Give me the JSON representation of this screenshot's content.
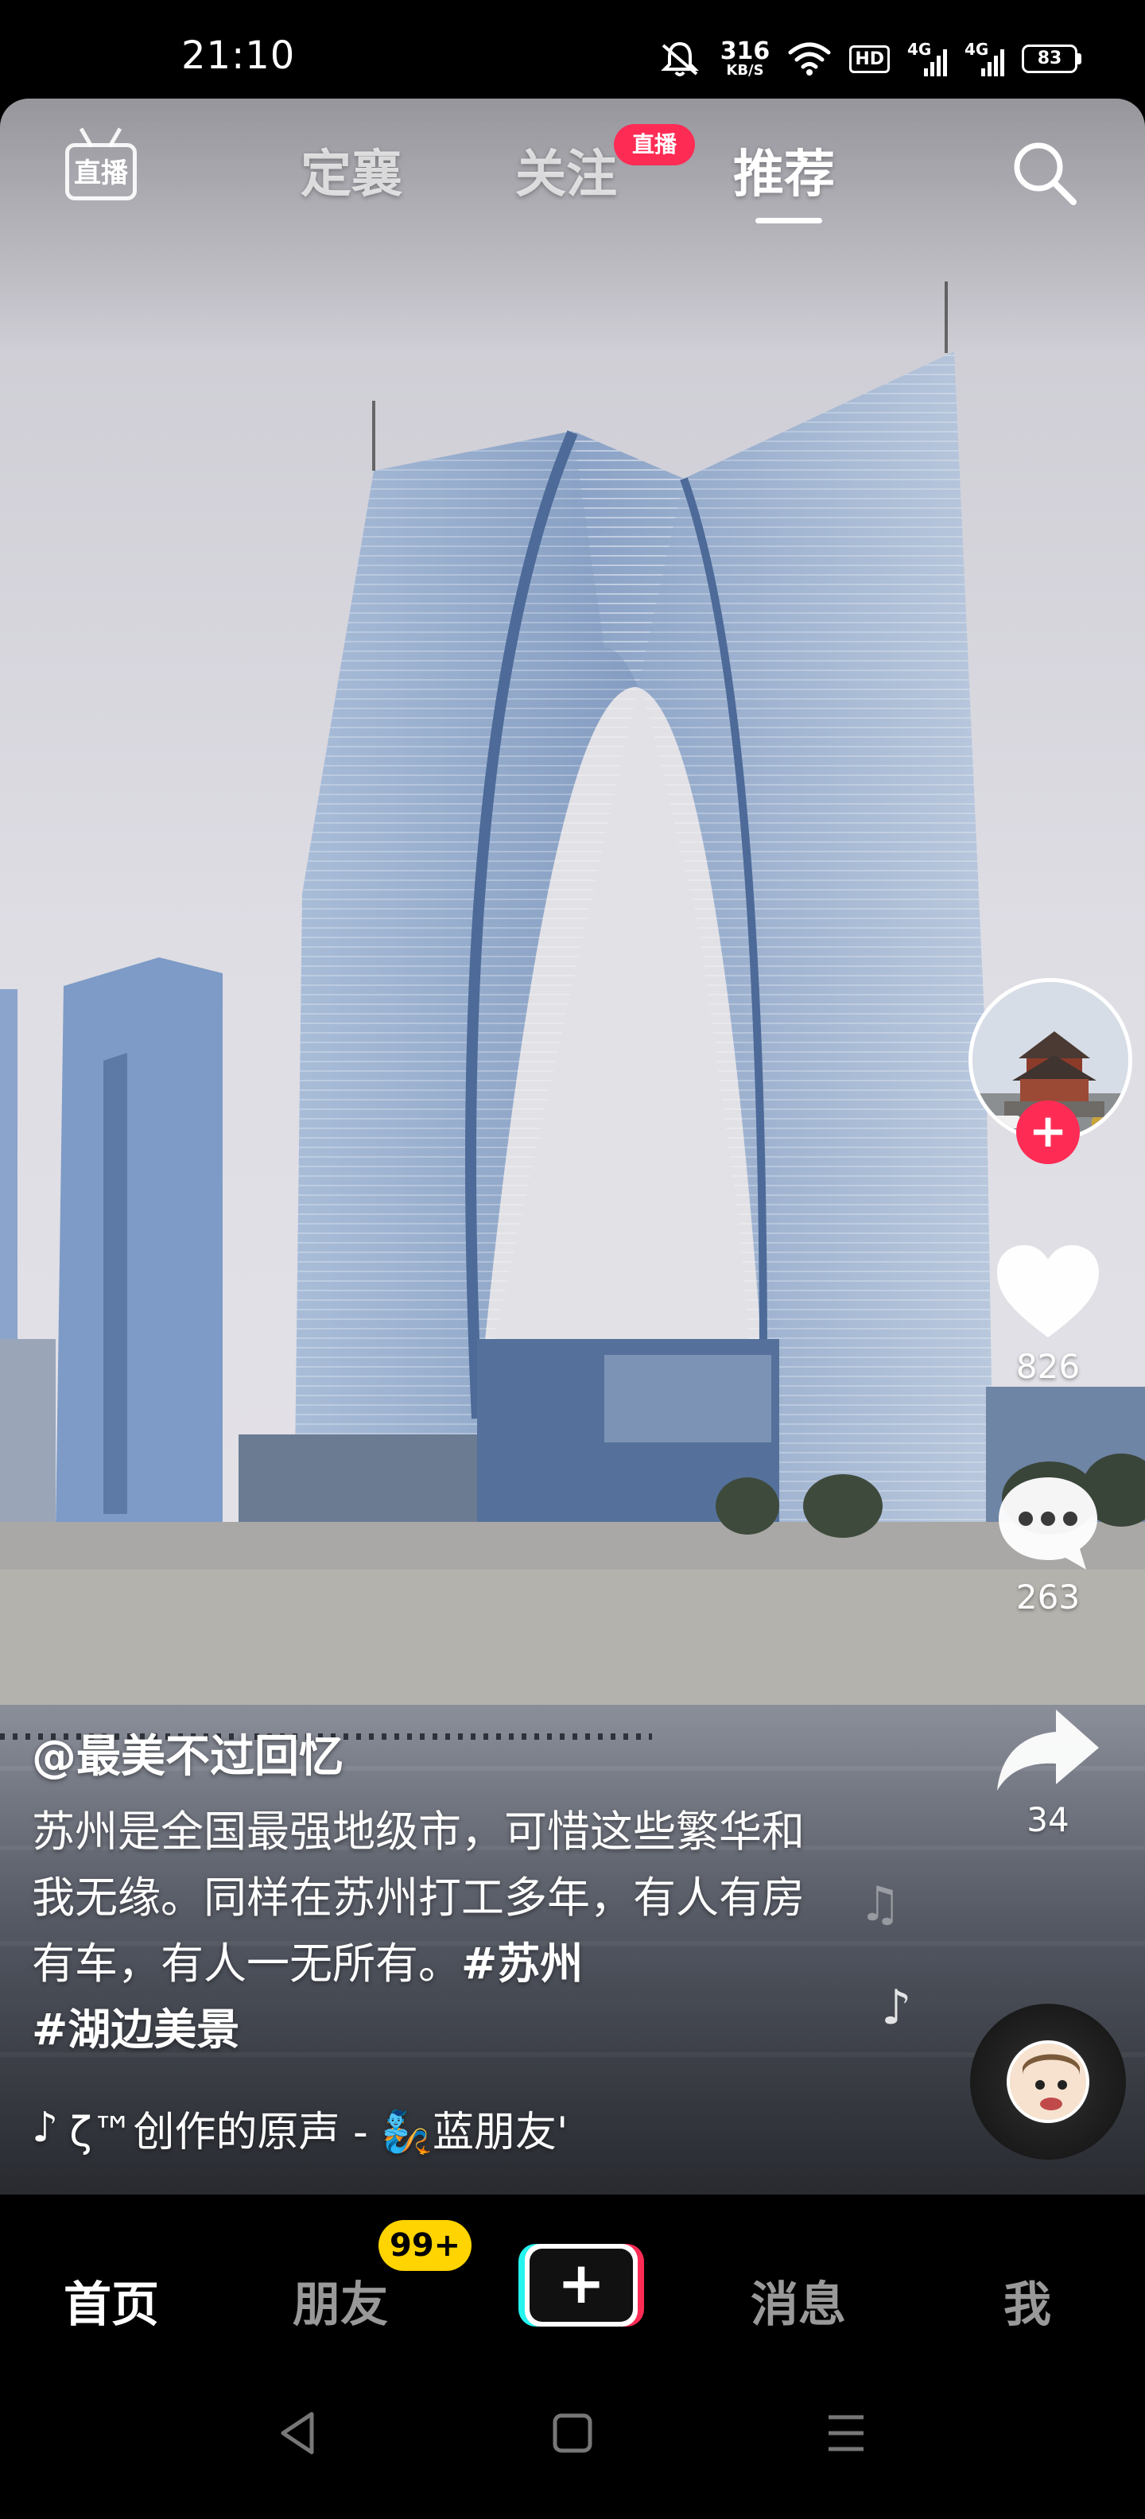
{
  "status_bar": {
    "time": "21:10",
    "net_speed_value": "316",
    "net_speed_unit": "KB/S",
    "hd_label": "HD",
    "sim1_label": "4G",
    "sim2_label": "4G",
    "battery": "83",
    "icons": [
      "mute-icon",
      "wifi-icon",
      "hd-icon",
      "signal-icon",
      "signal-icon",
      "battery-icon"
    ]
  },
  "top_nav": {
    "live_label": "直播",
    "tabs": [
      {
        "label": "定襄"
      },
      {
        "label": "关注"
      },
      {
        "label": "推荐"
      }
    ],
    "active_tab": "推荐",
    "follow_badge": "直播"
  },
  "actions": {
    "likes": "826",
    "comments": "263",
    "shares": "34",
    "follow_plus": "+"
  },
  "post": {
    "author": "@最美不过回忆",
    "caption_text": "苏州是全国最强地级市，可惜这些繁华和我无缘。同样在苏州打工多年，有人有房有车，有人一无所有。",
    "hashtag_1": "#苏州",
    "hashtag_2": "#湖边美景",
    "music": "ζ™创作的原声 - 🧞蓝朋友'"
  },
  "bottom_tabs": {
    "home": "首页",
    "friends": "朋友",
    "friends_badge": "99+",
    "create": "+",
    "messages": "消息",
    "me": "我",
    "active": "首页"
  },
  "colors": {
    "accent_red": "#fe2c55",
    "accent_cyan": "#25f4ee",
    "badge_yellow": "#ffd400"
  }
}
